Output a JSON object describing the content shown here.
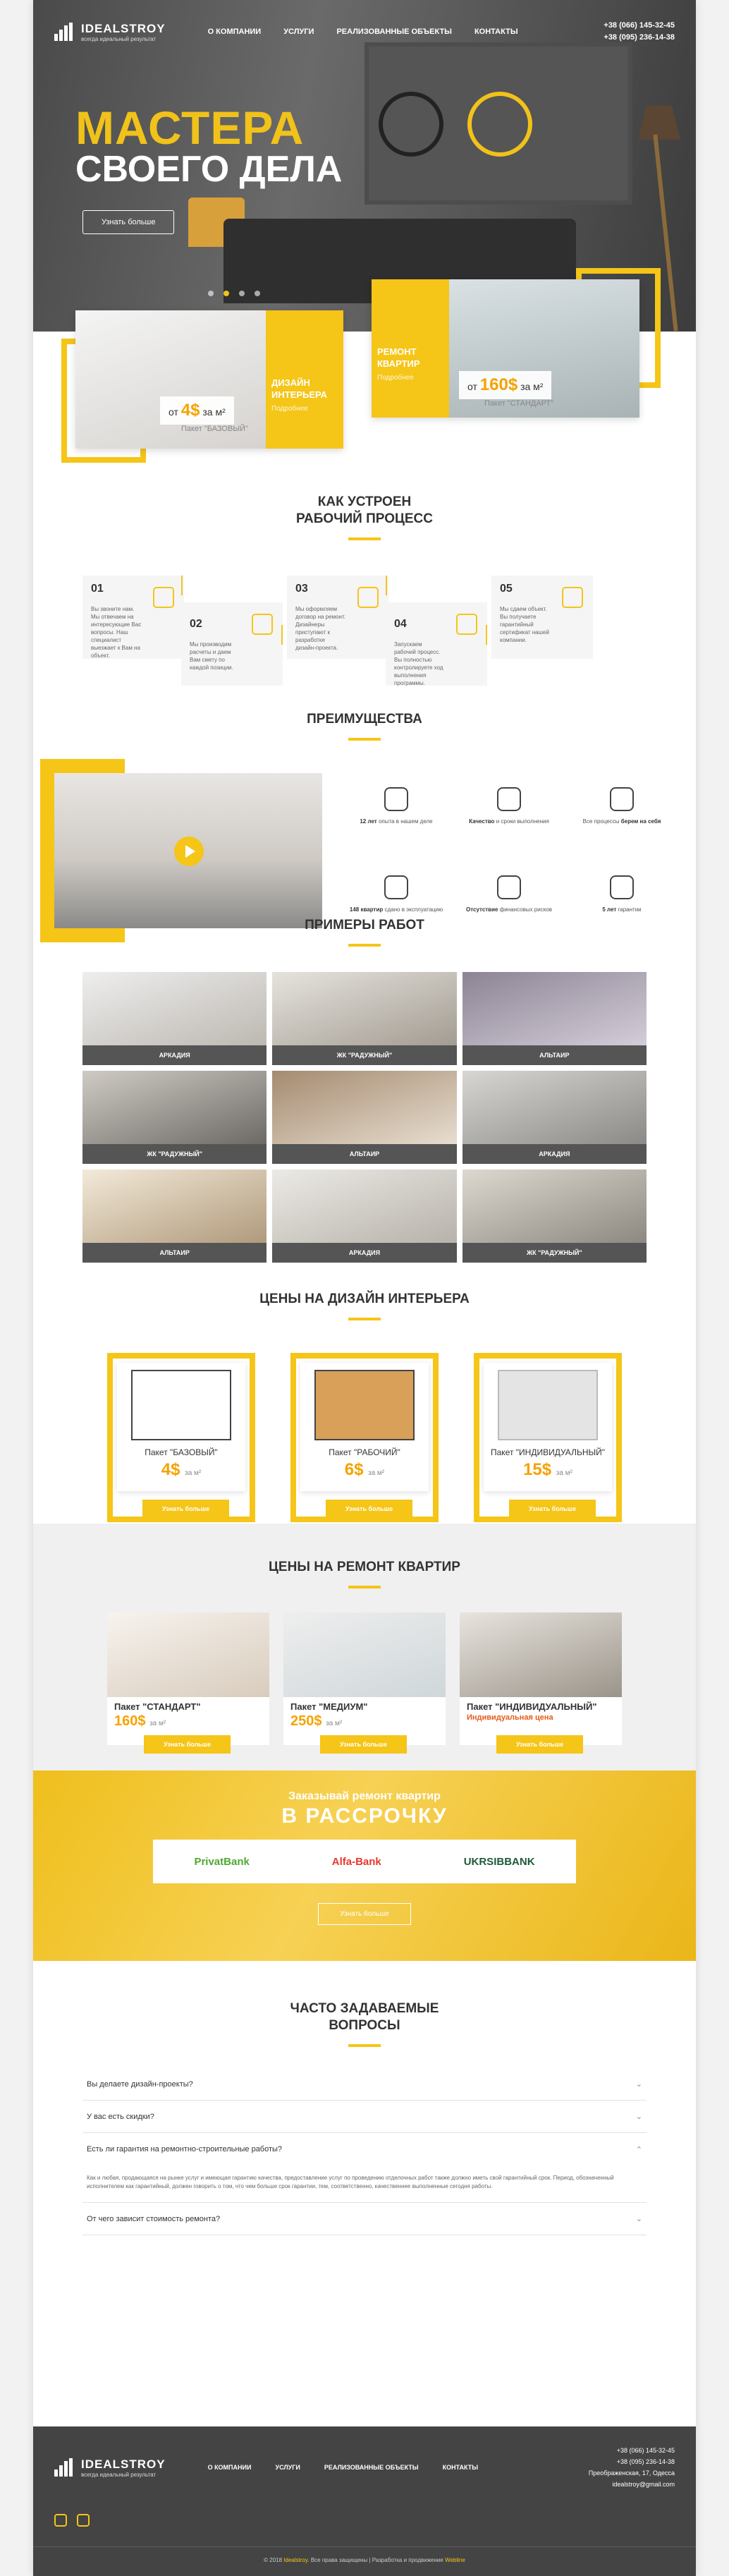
{
  "header": {
    "logo_title": "IDEALSTROY",
    "logo_sub": "всегда идеальный результат",
    "nav": [
      "О КОМПАНИИ",
      "УСЛУГИ",
      "РЕАЛИЗОВАННЫЕ ОБЪЕКТЫ",
      "КОНТАКТЫ"
    ],
    "phone1": "+38 (066) 145-32-45",
    "phone2": "+38 (095) 236-14-38"
  },
  "hero": {
    "title1": "МАСТЕРА",
    "title2": "СВОЕГО ДЕЛА",
    "button": "Узнать больше"
  },
  "promo": [
    {
      "price_prefix": "от",
      "price": "4$",
      "price_unit": "за м²",
      "package": "Пакет \"БАЗОВЫЙ\"",
      "label1": "ДИЗАЙН",
      "label2": "ИНТЕРЬЕРА",
      "label3": "Подробнее"
    },
    {
      "price_prefix": "от",
      "price": "160$",
      "price_unit": "за м²",
      "package": "Пакет \"СТАНДАРТ\"",
      "label1": "РЕМОНТ",
      "label2": "КВАРТИР",
      "label3": "Подробнее"
    }
  ],
  "process": {
    "title1": "КАК УСТРОЕН",
    "title2": "РАБОЧИЙ ПРОЦЕСС",
    "steps": [
      {
        "n": "01",
        "t": "Вы звоните нам. Мы отвечаем на интересующие Вас вопросы. Наш специалист выезжает к Вам на объект."
      },
      {
        "n": "02",
        "t": "Мы производим расчеты и даем Вам смету по каждой позиции."
      },
      {
        "n": "03",
        "t": "Мы оформляем договор на ремонт. Дизайнеры приступают к разработке дизайн-проекта."
      },
      {
        "n": "04",
        "t": "Запускаем рабочий процесс. Вы полностью контролируете ход выполнения программы."
      },
      {
        "n": "05",
        "t": "Мы сдаем объект. Вы получаете гарантийный сертификат нашей компании."
      }
    ]
  },
  "advantages": {
    "title": "ПРЕИМУЩЕСТВА",
    "items": [
      {
        "b": "12 лет",
        "t": "опыта в нашем деле"
      },
      {
        "b": "Качество",
        "t": "и сроки выполнения"
      },
      {
        "b": "берем на себя",
        "t": "Все процессы"
      },
      {
        "b": "148 квартир",
        "t": "сдано в эксплуатацию"
      },
      {
        "b": "Отсутствие",
        "t": "финансовых рисков"
      },
      {
        "b": "5 лет",
        "t": "гарантии"
      }
    ]
  },
  "works": {
    "title": "ПРИМЕРЫ РАБОТ",
    "items": [
      "АРКАДИЯ",
      "ЖК \"РАДУЖНЫЙ\"",
      "АЛЬТАИР",
      "ЖК \"РАДУЖНЫЙ\"",
      "АЛЬТАИР",
      "АРКАДИЯ",
      "АЛЬТАИР",
      "АРКАДИЯ",
      "ЖК \"РАДУЖНЫЙ\""
    ]
  },
  "design_prices": {
    "title": "ЦЕНЫ НА ДИЗАЙН ИНТЕРЬЕРА",
    "items": [
      {
        "name": "Пакет \"БАЗОВЫЙ\"",
        "price": "4$",
        "unit": "за м²",
        "button": "Узнать больше"
      },
      {
        "name": "Пакет \"РАБОЧИЙ\"",
        "price": "6$",
        "unit": "за м²",
        "button": "Узнать больше"
      },
      {
        "name": "Пакет \"ИНДИВИДУАЛЬНЫЙ\"",
        "price": "15$",
        "unit": "за м²",
        "button": "Узнать больше"
      }
    ]
  },
  "repair_prices": {
    "title": "ЦЕНЫ НА РЕМОНТ КВАРТИР",
    "items": [
      {
        "name": "Пакет \"СТАНДАРТ\"",
        "price": "160$",
        "unit": "за м²",
        "button": "Узнать больше"
      },
      {
        "name": "Пакет \"МЕДИУМ\"",
        "price": "250$",
        "unit": "за м²",
        "button": "Узнать больше"
      },
      {
        "name": "Пакет \"ИНДИВИДУАЛЬНЫЙ\"",
        "price": "Индивидуальная цена",
        "unit": "",
        "button": "Узнать больше"
      }
    ]
  },
  "credit": {
    "line1": "Заказывай ремонт квартир",
    "line2": "В РАССРОЧКУ",
    "banks": [
      "PrivatBank",
      "Alfa-Bank",
      "UKRSIBBANK"
    ],
    "button": "Узнать больше"
  },
  "faq": {
    "title1": "ЧАСТО ЗАДАВАЕМЫЕ",
    "title2": "ВОПРОСЫ",
    "items": [
      "Вы делаете дизайн-проекты?",
      "У вас есть скидки?",
      "Есть ли гарантия на ремонтно-строительные работы?",
      "От чего зависит стоимость ремонта?"
    ],
    "answer": "Как и любая, продающаяся на рынке услуг и имеющая гарантию качества, предоставление услуг по проведению отделочных работ также должно иметь свой гарантийный срок. Период, обозначенный исполнителем как гарантийный, должен говорить о том, что чем больше срок гарантии, тем, соответственно, качественнее выполненные сегодня работы."
  },
  "footer": {
    "nav": [
      "О КОМПАНИИ",
      "УСЛУГИ",
      "РЕАЛИЗОВАННЫЕ ОБЪЕКТЫ",
      "КОНТАКТЫ"
    ],
    "phone1": "+38 (066) 145-32-45",
    "phone2": "+38 (095) 236-14-38",
    "address": "Преображенская, 17, Одесса",
    "email": "idealstroy@gmail.com",
    "copy_pre": "© 2018 ",
    "copy_brand": "Idealstroy",
    "copy_mid": ". Все права защищены | Разработка и продвижение ",
    "copy_dev": "Webline"
  }
}
